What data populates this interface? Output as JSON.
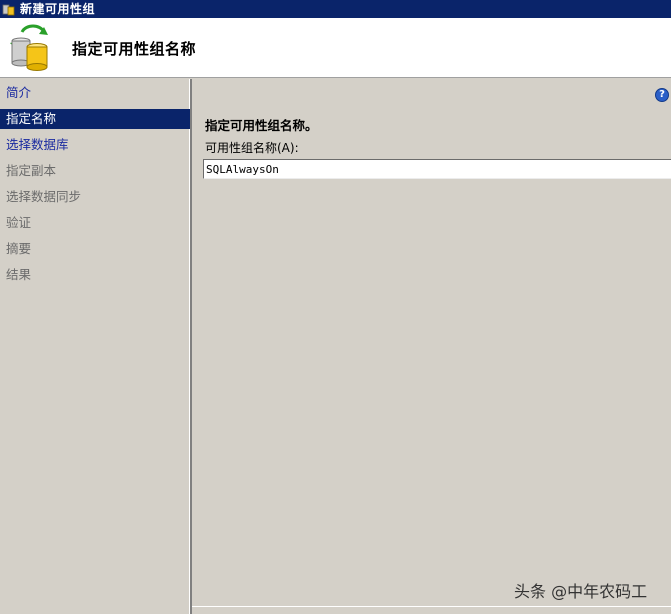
{
  "window": {
    "title": "新建可用性组"
  },
  "header": {
    "title": "指定可用性组名称"
  },
  "nav": {
    "items": [
      {
        "label": "简介",
        "state": "link"
      },
      {
        "label": "指定名称",
        "state": "active"
      },
      {
        "label": "选择数据库",
        "state": "link"
      },
      {
        "label": "指定副本",
        "state": "disabled"
      },
      {
        "label": "选择数据同步",
        "state": "disabled"
      },
      {
        "label": "验证",
        "state": "disabled"
      },
      {
        "label": "摘要",
        "state": "disabled"
      },
      {
        "label": "结果",
        "state": "disabled"
      }
    ]
  },
  "main": {
    "help_icon": "help-icon",
    "section_title": "指定可用性组名称。",
    "field_label": "可用性组名称(A):",
    "name_value": "SQLAlwaysOn"
  },
  "watermark": "头条 @中年农码工",
  "colors": {
    "titlebar": "#0a246a",
    "active": "#0a246a",
    "link": "#1a2aa0",
    "disabled": "#6b6b6b",
    "dialog_bg": "#d4d0c8"
  }
}
